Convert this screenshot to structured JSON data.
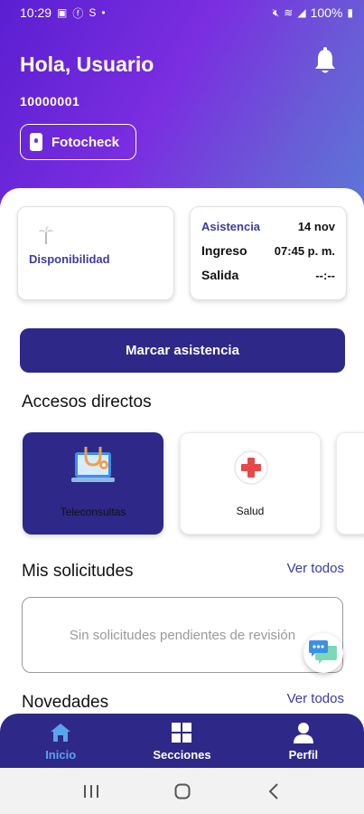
{
  "status_bar": {
    "time": "10:29",
    "battery": "100%"
  },
  "header": {
    "greeting": "Hola, Usuario",
    "user_id": "10000001",
    "fotocheck_label": "Fotocheck"
  },
  "availability": {
    "label": "Disponibilidad"
  },
  "attendance": {
    "title": "Asistencia",
    "date": "14 nov",
    "checkin_label": "Ingreso",
    "checkin_value": "07:45 p. m.",
    "checkout_label": "Salida",
    "checkout_value": "--:--"
  },
  "mark_button": "Marcar asistencia",
  "shortcuts": {
    "title": "Accesos directos",
    "items": [
      {
        "label": "Teleconsultas",
        "icon": "telemedicine-icon"
      },
      {
        "label": "Salud",
        "icon": "health-cross-icon"
      }
    ]
  },
  "requests": {
    "title": "Mis solicitudes",
    "see_all": "Ver todos",
    "empty": "Sin solicitudes pendientes de revisión"
  },
  "news": {
    "title": "Novedades",
    "see_all": "Ver todos"
  },
  "bottom_nav": {
    "items": [
      {
        "label": "Inicio",
        "icon": "home-icon",
        "active": true
      },
      {
        "label": "Secciones",
        "icon": "grid-icon",
        "active": false
      },
      {
        "label": "Perfil",
        "icon": "person-icon",
        "active": false
      }
    ]
  },
  "colors": {
    "primary": "#2e2888",
    "accent_text": "#3b3ba8",
    "active_nav": "#5aa4ee",
    "header_gradient_start": "#5a1fd1",
    "header_gradient_end": "#5c78d8"
  }
}
